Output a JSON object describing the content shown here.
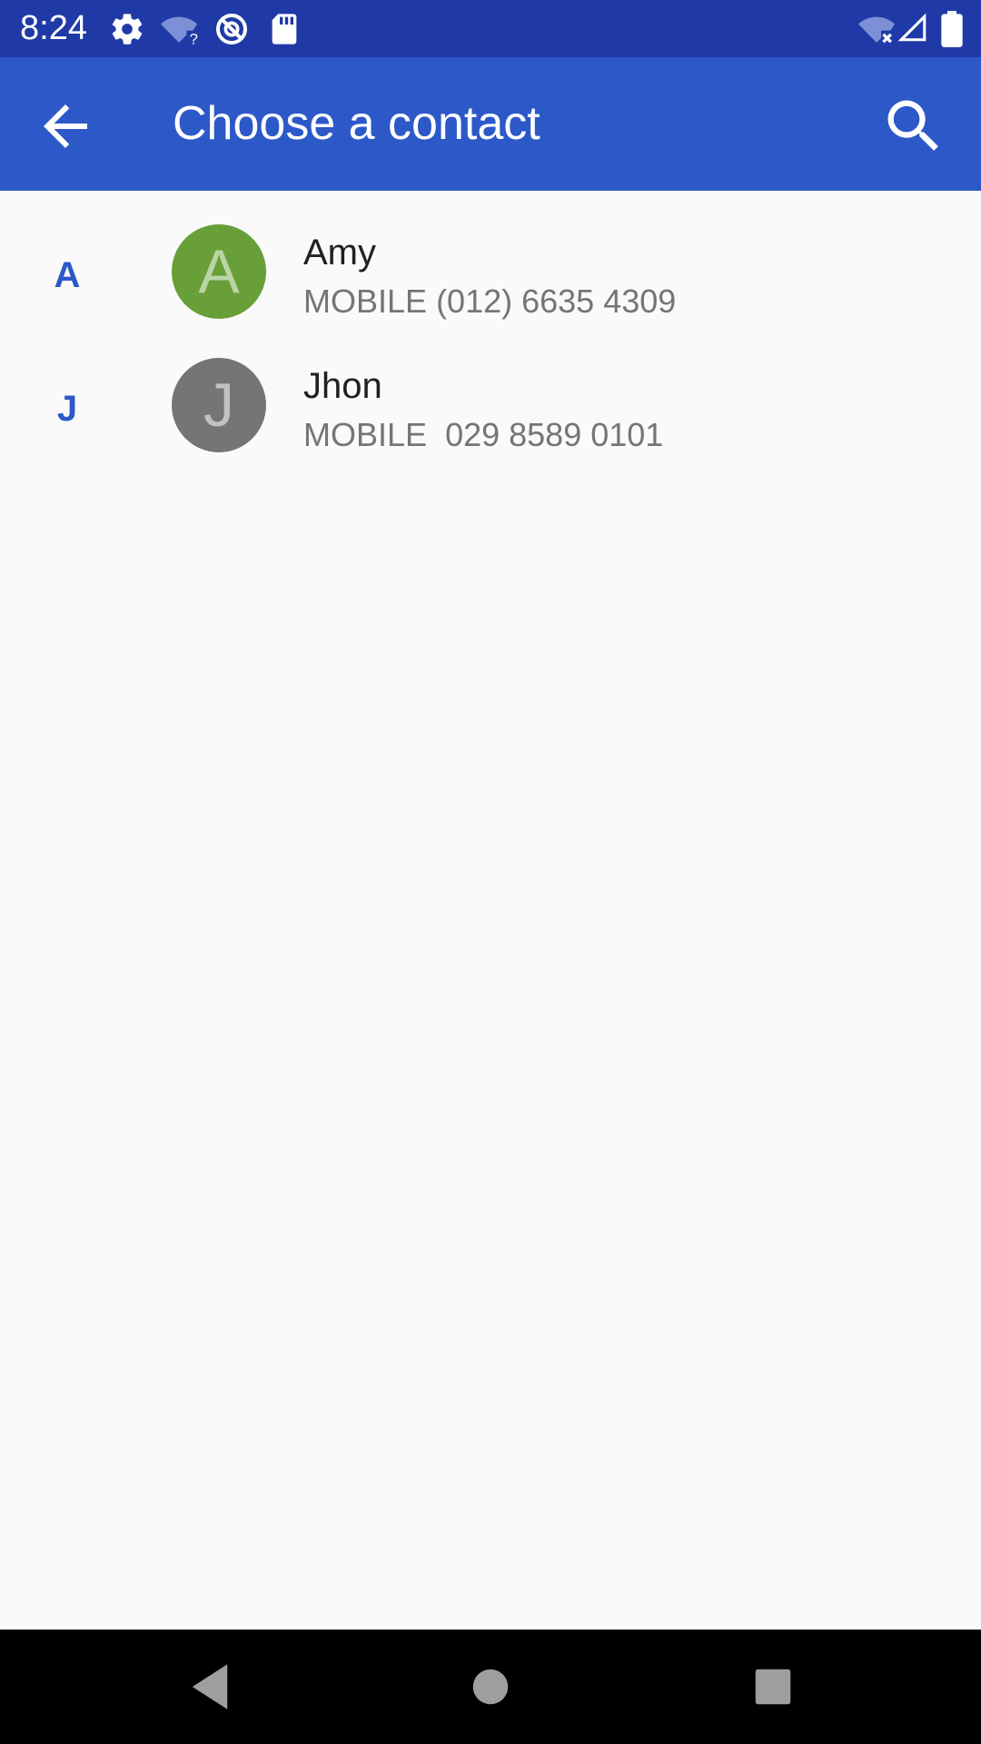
{
  "status_bar": {
    "time": "8:24",
    "left_icons": [
      "gear-icon",
      "wifi-question-icon",
      "vpn-icon",
      "sd-card-icon"
    ],
    "right_icons": [
      "wifi-off-icon",
      "cell-signal-icon",
      "battery-icon"
    ]
  },
  "app_bar": {
    "title": "Choose a contact",
    "back_icon": "arrow-back-icon",
    "search_icon": "search-icon"
  },
  "contacts": [
    {
      "section": "A",
      "initial": "A",
      "name": "Amy",
      "phone_type": "MOBILE",
      "phone": "(012) 6635 4309",
      "avatar_color": "#689f38"
    },
    {
      "section": "J",
      "initial": "J",
      "name": "Jhon",
      "phone_type": "MOBILE",
      "phone": " 029 8589 0101",
      "avatar_color": "#757575"
    }
  ],
  "colors": {
    "status_bar": "#1f3aa6",
    "app_bar": "#2c58c8",
    "background": "#fafafa",
    "nav_bar": "#000000"
  },
  "nav_bar": {
    "buttons": [
      "back-triangle-icon",
      "home-circle-icon",
      "recents-square-icon"
    ]
  }
}
